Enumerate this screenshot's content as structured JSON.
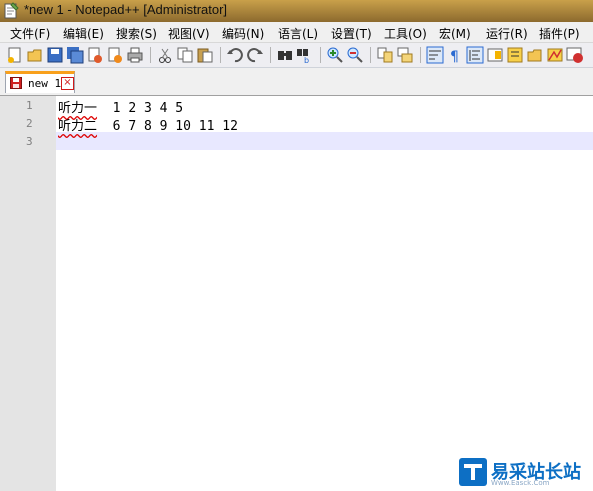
{
  "window": {
    "title": "*new 1 - Notepad++ [Administrator]"
  },
  "menubar": {
    "items": [
      "文件(F)",
      "编辑(E)",
      "搜索(S)",
      "视图(V)",
      "编码(N)",
      "语言(L)",
      "设置(T)",
      "工具(O)",
      "宏(M)",
      "运行(R)",
      "插件(P)"
    ]
  },
  "toolbar": {
    "buttons": [
      "new-file-icon",
      "open-file-icon",
      "save-icon",
      "save-all-icon",
      "close-icon",
      "close-all-icon",
      "print-icon",
      "cut-icon",
      "copy-icon",
      "paste-icon",
      "undo-icon",
      "redo-icon",
      "find-icon",
      "replace-icon",
      "zoom-in-icon",
      "zoom-out-icon",
      "sync-vertical-icon",
      "sync-horizontal-icon",
      "word-wrap-icon",
      "show-all-chars-icon",
      "indent-guide-icon",
      "doc-map-icon",
      "function-list-icon",
      "macro-record-icon"
    ]
  },
  "tabs": [
    {
      "label": "new 1",
      "close_symbol": "×"
    }
  ],
  "editor": {
    "lines": [
      {
        "number": "1",
        "label": "听力一",
        "text": "  1 2 3 4 5"
      },
      {
        "number": "2",
        "label": "听力二",
        "text": "  6 7 8 9 10 11 12"
      },
      {
        "number": "3",
        "label": "",
        "text": ""
      }
    ],
    "current_line": "3"
  },
  "watermark": {
    "text": "易采站长站",
    "sub": "Www.Easck.Com"
  },
  "colors": {
    "tab_accent": "#f8a01c",
    "current_line": "#e8e8ff",
    "gutter": "#e4e4e4",
    "watermark": "#0d6fc4"
  }
}
